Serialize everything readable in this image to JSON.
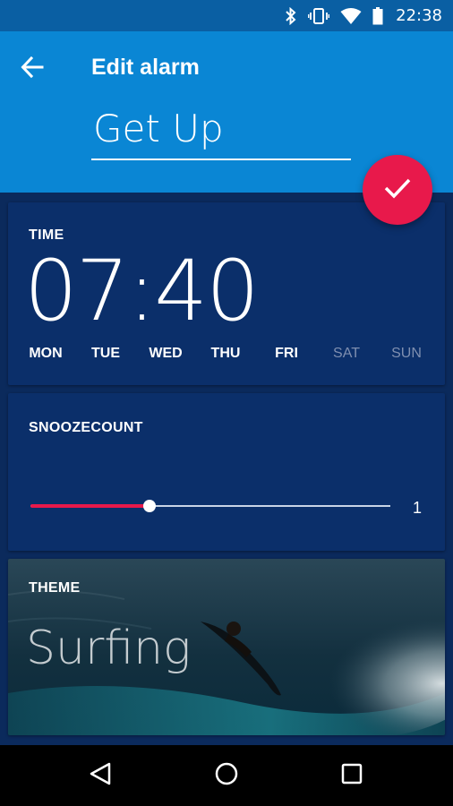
{
  "status_bar": {
    "time": "22:38",
    "icons": [
      "bluetooth-icon",
      "vibrate-icon",
      "wifi-icon",
      "battery-icon"
    ]
  },
  "app_bar": {
    "title": "Edit alarm",
    "alarm_name": "Get Up",
    "back_icon": "arrow-back-icon"
  },
  "fab": {
    "icon": "check-icon",
    "color": "#e8194b"
  },
  "time_card": {
    "label": "TIME",
    "time": "07:40",
    "days": [
      {
        "label": "MON",
        "active": true
      },
      {
        "label": "TUE",
        "active": true
      },
      {
        "label": "WED",
        "active": true
      },
      {
        "label": "THU",
        "active": true
      },
      {
        "label": "FRI",
        "active": true
      },
      {
        "label": "SAT",
        "active": false
      },
      {
        "label": "SUN",
        "active": false
      }
    ]
  },
  "snooze_card": {
    "label": "SNOOZECOUNT",
    "value": "1",
    "slider_fraction": 0.33
  },
  "theme_card": {
    "label": "THEME",
    "name": "Surfing"
  },
  "nav_bar": {
    "buttons": [
      "back-triangle-icon",
      "home-circle-icon",
      "recents-square-icon"
    ]
  },
  "colors": {
    "primary": "#0a86d4",
    "status_bar": "#0a5fa3",
    "card": "#0b2f6a",
    "background": "#0b2a5c",
    "accent": "#e8194b"
  }
}
